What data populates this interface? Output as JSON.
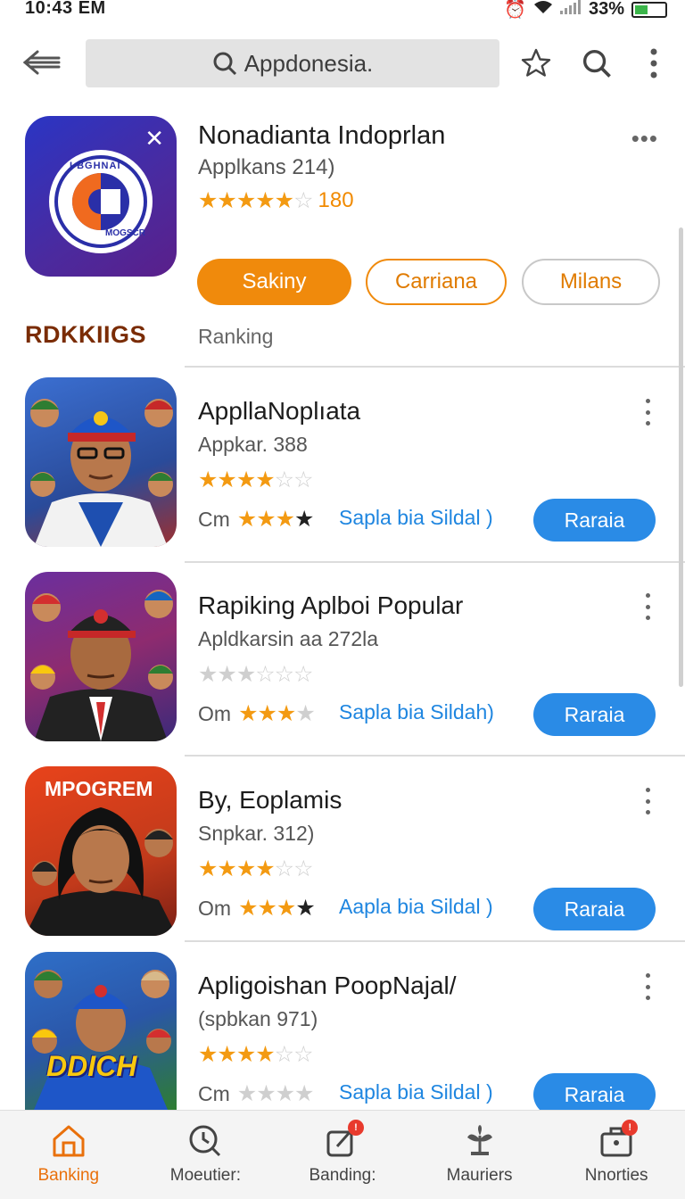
{
  "status_bar": {
    "time": "10:43 EM",
    "battery": "33%"
  },
  "top_bar": {
    "search_text": "Appdonesia."
  },
  "featured": {
    "title": "Nonadianta Indoprlan",
    "subtitle": "Applkans 214)",
    "rating_count": "180",
    "buttons": {
      "primary": "Sakiny",
      "secondary": "Carriana",
      "tertiary": "Milans"
    },
    "icon_text_top": "I BGHNAI",
    "icon_text_bottom": "MOGSCR"
  },
  "section": {
    "title": "RDKKIIGS",
    "subtitle": "Ranking"
  },
  "apps": [
    {
      "name": "AppllaNoplıata",
      "subtitle": "Appkar. 388",
      "meta": "Cm",
      "link": "Sapla bia Sildal )",
      "install": "Raraia"
    },
    {
      "name": "Rapiking Aplboi Popular",
      "subtitle": "Apldkarsin aa 272la",
      "meta": "Om",
      "link": "Sapla bia Sildah)",
      "install": "Raraia"
    },
    {
      "name": "By, Eoplamis",
      "subtitle": "Snpkar. 312)",
      "meta": "Om",
      "link": "Aapla bia Sildal )",
      "install": "Raraia",
      "thumb_label": "MPOGREM"
    },
    {
      "name": "Apligoishan PoopNajal/",
      "subtitle": "(spbkan 971)",
      "meta": "Cm",
      "link": "Sapla bia Sildal )",
      "install": "Raraia",
      "thumb_label": "DDICH"
    }
  ],
  "bottom_nav": [
    {
      "label": "Banking"
    },
    {
      "label": "Moeutier:"
    },
    {
      "label": "Banding:"
    },
    {
      "label": "Mauriers"
    },
    {
      "label": "Nnorties"
    }
  ],
  "colors": {
    "accent": "#f08a0c",
    "install": "#2a8be6",
    "link": "#1f86e0",
    "section": "#7a2c05"
  }
}
